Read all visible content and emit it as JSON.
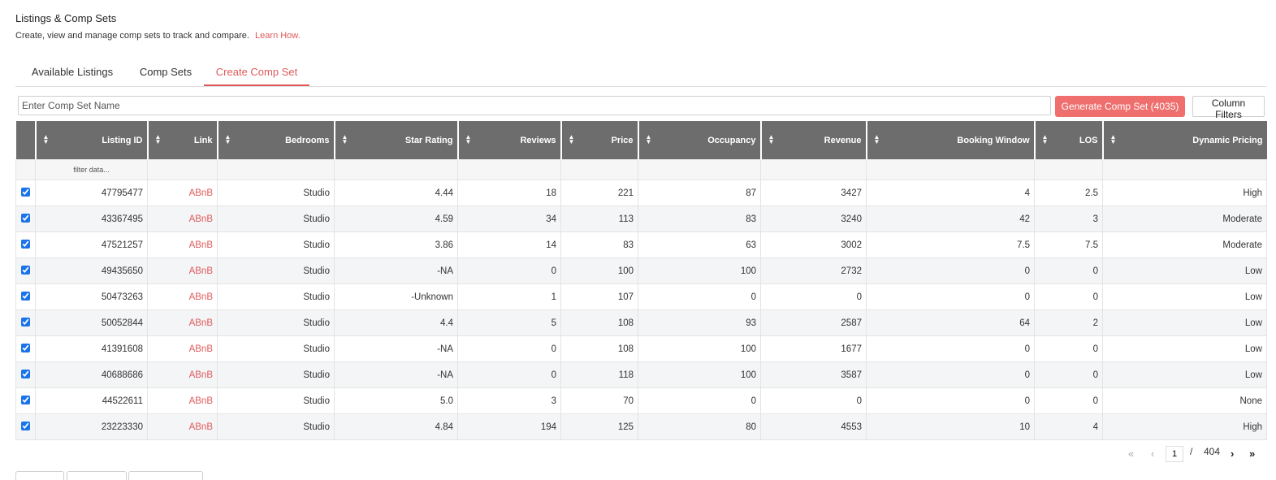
{
  "header": {
    "title": "Listings & Comp Sets",
    "subtitle": "Create, view and manage comp sets to track and compare.",
    "learn_link": "Learn How."
  },
  "tabs": [
    {
      "label": "Available Listings",
      "active": false
    },
    {
      "label": "Comp Sets",
      "active": false
    },
    {
      "label": "Create Comp Set",
      "active": true
    }
  ],
  "toolbar": {
    "name_placeholder": "Enter Comp Set Name",
    "generate_label": "Generate Comp Set (4035)",
    "filters_label": "Column Filters"
  },
  "table": {
    "columns": [
      "Listing ID",
      "Link",
      "Bedrooms",
      "Star Rating",
      "Reviews",
      "Price",
      "Occupancy",
      "Revenue",
      "Booking Window",
      "LOS",
      "Dynamic Pricing"
    ],
    "filter_placeholder": "filter data...",
    "rows": [
      {
        "checked": true,
        "cells": [
          "47795477",
          "ABnB",
          "Studio",
          "4.44",
          "18",
          "221",
          "87",
          "3427",
          "4",
          "2.5",
          "High"
        ]
      },
      {
        "checked": true,
        "cells": [
          "43367495",
          "ABnB",
          "Studio",
          "4.59",
          "34",
          "113",
          "83",
          "3240",
          "42",
          "3",
          "Moderate"
        ]
      },
      {
        "checked": true,
        "cells": [
          "47521257",
          "ABnB",
          "Studio",
          "3.86",
          "14",
          "83",
          "63",
          "3002",
          "7.5",
          "7.5",
          "Moderate"
        ]
      },
      {
        "checked": true,
        "cells": [
          "49435650",
          "ABnB",
          "Studio",
          "-NA",
          "0",
          "100",
          "100",
          "2732",
          "0",
          "0",
          "Low"
        ]
      },
      {
        "checked": true,
        "cells": [
          "50473263",
          "ABnB",
          "Studio",
          "-Unknown",
          "1",
          "107",
          "0",
          "0",
          "0",
          "0",
          "Low"
        ]
      },
      {
        "checked": true,
        "cells": [
          "50052844",
          "ABnB",
          "Studio",
          "4.4",
          "5",
          "108",
          "93",
          "2587",
          "64",
          "2",
          "Low"
        ]
      },
      {
        "checked": true,
        "cells": [
          "41391608",
          "ABnB",
          "Studio",
          "-NA",
          "0",
          "108",
          "100",
          "1677",
          "0",
          "0",
          "Low"
        ]
      },
      {
        "checked": true,
        "cells": [
          "40688686",
          "ABnB",
          "Studio",
          "-NA",
          "0",
          "118",
          "100",
          "3587",
          "0",
          "0",
          "Low"
        ]
      },
      {
        "checked": true,
        "cells": [
          "44522611",
          "ABnB",
          "Studio",
          "5.0",
          "3",
          "70",
          "0",
          "0",
          "0",
          "0",
          "None"
        ]
      },
      {
        "checked": true,
        "cells": [
          "23223330",
          "ABnB",
          "Studio",
          "4.84",
          "194",
          "125",
          "80",
          "4553",
          "10",
          "4",
          "High"
        ]
      }
    ]
  },
  "pagination": {
    "current_page": "1",
    "separator": "/",
    "total_pages": "404"
  },
  "colors": {
    "accent": "#e05a5a",
    "header_bg": "#6d6d6d",
    "button": "#ef6f6f"
  }
}
